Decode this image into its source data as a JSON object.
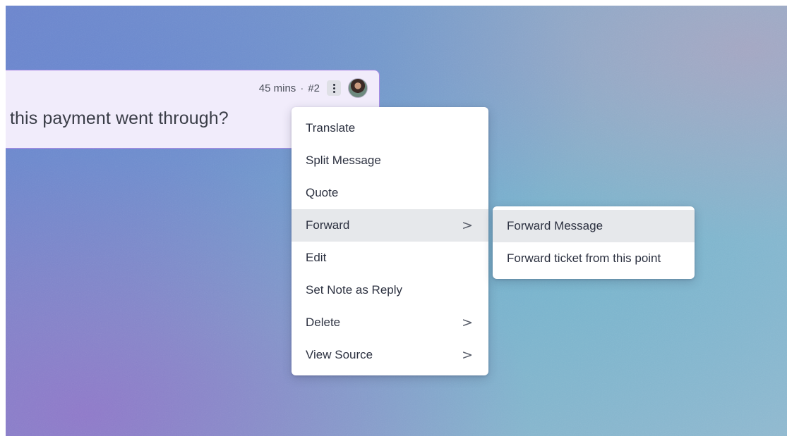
{
  "message": {
    "time": "45 mins",
    "separator": "·",
    "number": "#2",
    "text": "this payment went through?"
  },
  "context_menu": {
    "items": [
      {
        "label": "Translate",
        "has_submenu": false
      },
      {
        "label": "Split Message",
        "has_submenu": false
      },
      {
        "label": "Quote",
        "has_submenu": false
      },
      {
        "label": "Forward",
        "has_submenu": true,
        "active": true
      },
      {
        "label": "Edit",
        "has_submenu": false
      },
      {
        "label": "Set Note as Reply",
        "has_submenu": false
      },
      {
        "label": "Delete",
        "has_submenu": true
      },
      {
        "label": "View Source",
        "has_submenu": true
      }
    ],
    "chevron_glyph": ">"
  },
  "forward_submenu": {
    "items": [
      {
        "label": "Forward Message",
        "active": true
      },
      {
        "label": "Forward ticket from this point",
        "active": false
      }
    ]
  },
  "colors": {
    "card_background": "#f1ecfb",
    "card_border": "#a98be6",
    "menu_hover": "#e6e8eb"
  }
}
